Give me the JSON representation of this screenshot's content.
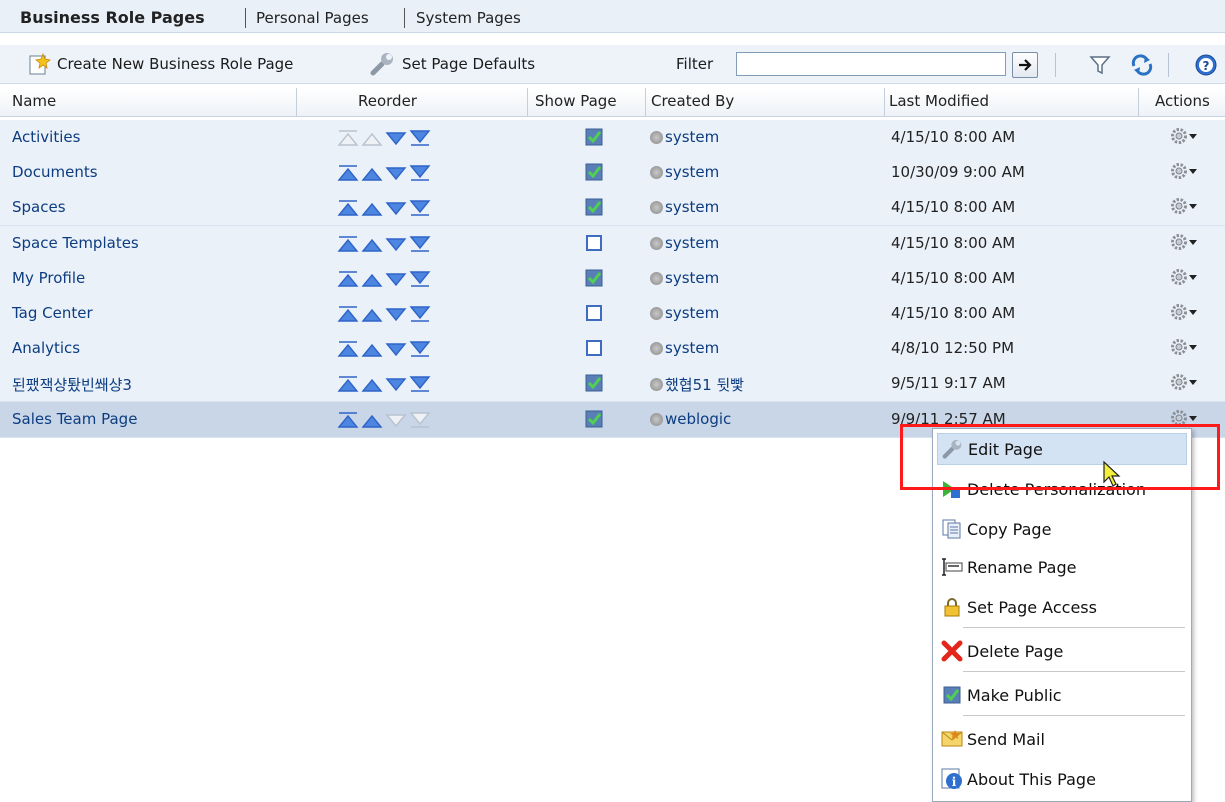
{
  "tabs": [
    "Business Role Pages",
    "Personal Pages",
    "System Pages"
  ],
  "toolbar": {
    "create_label": "Create New Business Role Page",
    "defaults_label": "Set Page Defaults",
    "filter_label": "Filter",
    "filter_value": ""
  },
  "columns": {
    "name": "Name",
    "reorder": "Reorder",
    "show_page": "Show Page",
    "created_by": "Created By",
    "last_modified": "Last Modified",
    "actions": "Actions"
  },
  "rows": [
    {
      "name": "Activities",
      "show": true,
      "creator": "system",
      "modified": "4/15/10 8:00 AM"
    },
    {
      "name": "Documents",
      "show": true,
      "creator": "system",
      "modified": "10/30/09 9:00 AM"
    },
    {
      "name": "Spaces",
      "show": true,
      "creator": "system",
      "modified": "4/15/10 8:00 AM"
    },
    {
      "name": "Space Templates",
      "show": false,
      "creator": "system",
      "modified": "4/15/10 8:00 AM"
    },
    {
      "name": "My Profile",
      "show": true,
      "creator": "system",
      "modified": "4/15/10 8:00 AM"
    },
    {
      "name": "Tag Center",
      "show": false,
      "creator": "system",
      "modified": "4/15/10 8:00 AM"
    },
    {
      "name": "Analytics",
      "show": false,
      "creator": "system",
      "modified": "4/8/10 12:50 PM"
    },
    {
      "name": "된팼잭샹퇐빈쐐샹3",
      "show": true,
      "creator": "했협51 뒷빷",
      "modified": "9/5/11 9:17 AM"
    },
    {
      "name": "Sales Team Page",
      "show": true,
      "creator": "weblogic",
      "modified": "9/9/11 2:57 AM"
    }
  ],
  "menu": [
    {
      "label": "Edit Page",
      "icon": "wrench-icon"
    },
    {
      "label": "Delete Personalization",
      "icon": "delete-personalization-icon"
    },
    {
      "label": "Copy Page",
      "icon": "copy-icon"
    },
    {
      "label": "Rename Page",
      "icon": "rename-icon"
    },
    {
      "label": "Set Page Access",
      "icon": "lock-icon"
    },
    {
      "label": "Delete Page",
      "icon": "red-x-icon"
    },
    {
      "label": "Make Public",
      "icon": "checkmark-icon"
    },
    {
      "label": "Send Mail",
      "icon": "envelope-icon"
    },
    {
      "label": "About This Page",
      "icon": "info-icon"
    }
  ],
  "colors": {
    "accent": "#0d3d80",
    "highlight_box": "#ff1a1a",
    "row_bg": "#ebf1f9",
    "selected_row_bg": "#c8d6e8"
  }
}
